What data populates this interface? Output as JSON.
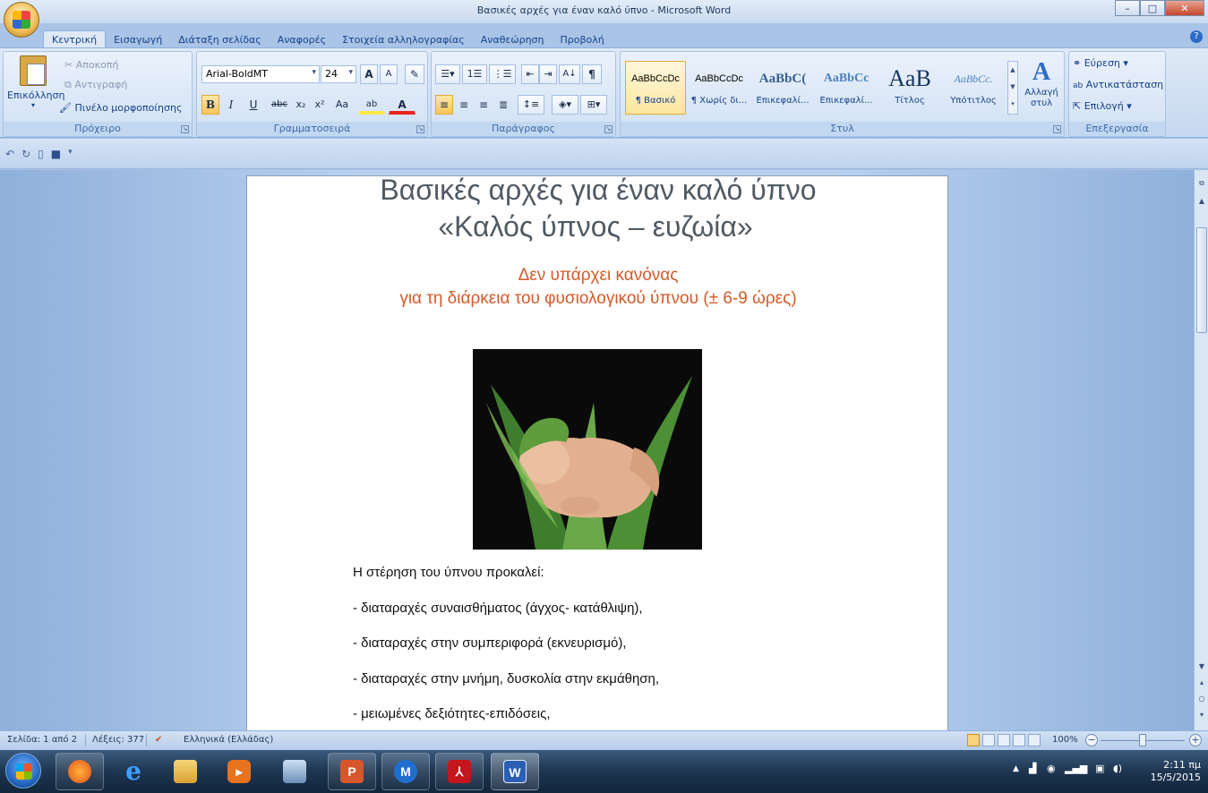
{
  "window": {
    "title": "Βασικές αρχές για έναν καλό ύπνο - Microsoft Word",
    "controls": {
      "minimize": "–",
      "maximize": "□",
      "close": "✕"
    }
  },
  "tabs": [
    {
      "label": "Κεντρική",
      "active": true
    },
    {
      "label": "Εισαγωγή"
    },
    {
      "label": "Διάταξη σελίδας"
    },
    {
      "label": "Αναφορές"
    },
    {
      "label": "Στοιχεία αλληλογραφίας"
    },
    {
      "label": "Αναθεώρηση"
    },
    {
      "label": "Προβολή"
    }
  ],
  "ribbon": {
    "clipboard": {
      "label": "Πρόχειρο",
      "paste": "Επικόλληση",
      "cut": "Αποκοπή",
      "copy": "Αντιγραφή",
      "format_painter": "Πινέλο μορφοποίησης"
    },
    "font": {
      "label": "Γραμματοσειρά",
      "font_name": "Arial-BoldMT",
      "font_size": "24",
      "bold": "B",
      "italic": "I",
      "underline": "U",
      "strike": "abc",
      "subscript": "x₂",
      "superscript": "x²",
      "change_case": "Aa",
      "grow": "A",
      "shrink": "A"
    },
    "paragraph": {
      "label": "Παράγραφος",
      "sort": "A↓",
      "pilcrow": "¶"
    },
    "styles": {
      "label": "Στυλ",
      "items": [
        {
          "sample": "AaBbCcDc",
          "name": "¶ Βασικό",
          "selected": true
        },
        {
          "sample": "AaBbCcDc",
          "name": "¶ Χωρίς δι..."
        },
        {
          "sample": "AaBbC(",
          "name": "Επικεφαλί..."
        },
        {
          "sample": "AaBbCc",
          "name": "Επικεφαλί..."
        },
        {
          "sample": "AaB",
          "name": "Τίτλος"
        },
        {
          "sample": "AaBbCc.",
          "name": "Υπότιτλος"
        }
      ],
      "change_styles": "Αλλαγή στυλ"
    },
    "editing": {
      "label": "Επεξεργασία",
      "find": "Εύρεση",
      "replace": "Αντικατάσταση",
      "select": "Επιλογή"
    }
  },
  "document": {
    "title_line1": "Βασικές αρχές για έναν καλό ύπνο",
    "title_line2": "«Καλός ύπνος – ευζωία»",
    "sub_line1": "Δεν υπάρχει κανόνας",
    "sub_line2": "για τη διάρκεια  του φυσιολογικού  ύπνου (± 6-9 ώρες)",
    "paragraphs": [
      "Η στέρηση του ύπνου προκαλεί:",
      "- διαταραχές συναισθήματος (άγχος- κατάθλιψη),",
      "- διαταραχές στην συμπεριφορά (εκνευρισμό),",
      "- διαταραχές στην μνήμη, δυσκολία στην εκμάθηση,",
      "- μειωμένες δεξιότητες-επιδόσεις,"
    ]
  },
  "status": {
    "page": "Σελίδα: 1 από 2",
    "words": "Λέξεις: 377",
    "language": "Ελληνικά (Ελλάδας)",
    "zoom": "100%"
  },
  "taskbar": {
    "time": "2:11 πμ",
    "date": "15/5/2015"
  },
  "colors": {
    "title_gray": "#505a64",
    "subtitle_orange": "#d35a2a",
    "ribbon_text": "#15428b"
  }
}
